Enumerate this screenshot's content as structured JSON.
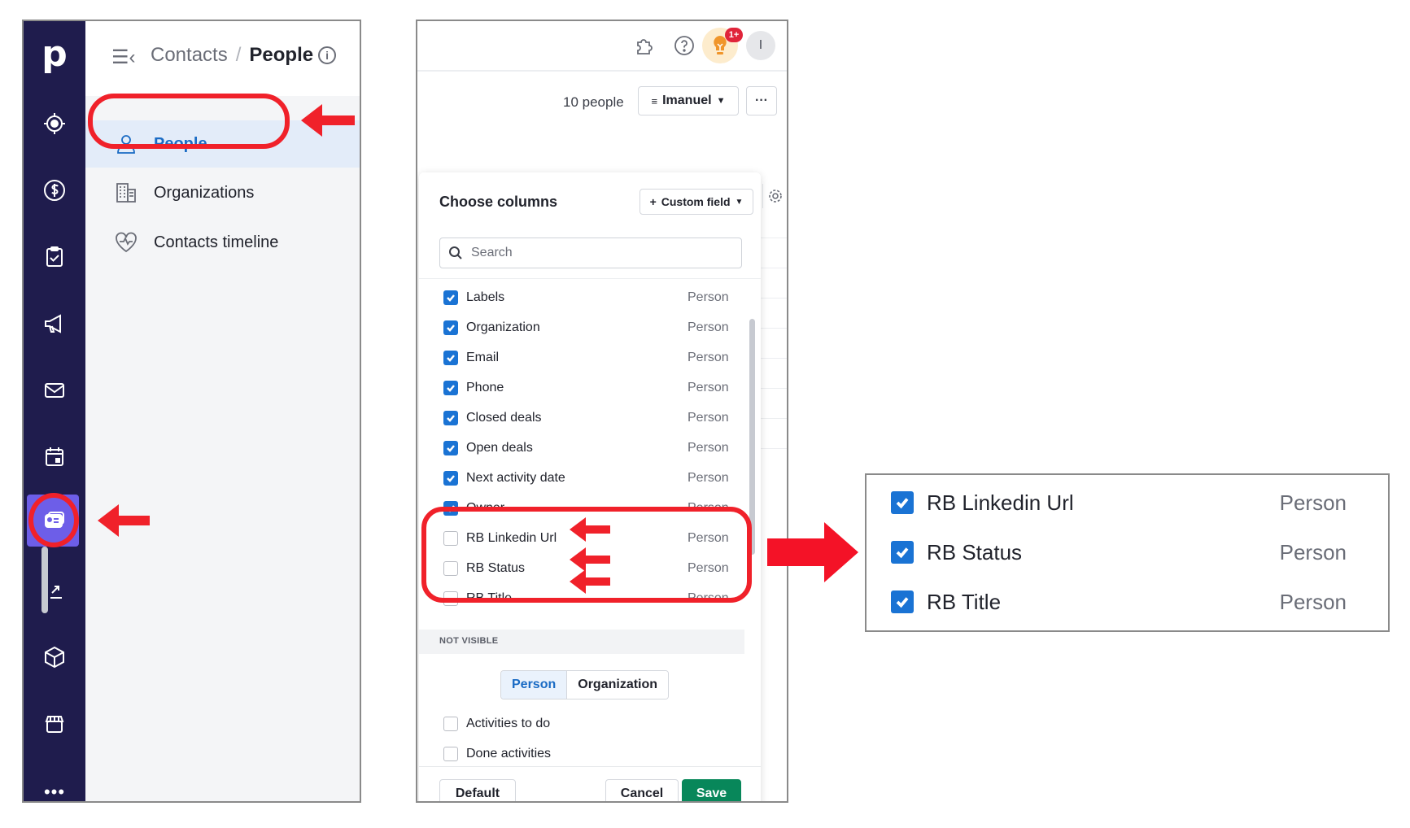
{
  "left_panel": {
    "logo": "p",
    "rail_icons": [
      "target-icon",
      "dollar-icon",
      "clipboard-check-icon",
      "megaphone-icon",
      "mail-icon",
      "calendar-icon",
      "contacts-card-icon",
      "chart-icon",
      "box-icon",
      "store-icon"
    ],
    "rail_active": "contacts-card-icon",
    "rail_more": "•••",
    "breadcrumb": {
      "parent": "Contacts",
      "separator": "/",
      "current": "People",
      "info": "i"
    },
    "nav": [
      {
        "label": "People",
        "icon": "person-icon",
        "active": true
      },
      {
        "label": "Organizations",
        "icon": "building-icon",
        "active": false
      },
      {
        "label": "Contacts timeline",
        "icon": "heart-pulse-icon",
        "active": false
      }
    ]
  },
  "middle_panel": {
    "topbar": {
      "notification_badge": "1+",
      "avatar_initial": "I"
    },
    "people_count": "10 people",
    "filter_label": "Imanuel",
    "more_label": "···",
    "choose_columns": {
      "title": "Choose columns",
      "custom_field_label": "Custom field",
      "search_placeholder": "Search",
      "visible_columns": [
        {
          "label": "Labels",
          "type": "Person",
          "checked": true
        },
        {
          "label": "Organization",
          "type": "Person",
          "checked": true
        },
        {
          "label": "Email",
          "type": "Person",
          "checked": true
        },
        {
          "label": "Phone",
          "type": "Person",
          "checked": true
        },
        {
          "label": "Closed deals",
          "type": "Person",
          "checked": true
        },
        {
          "label": "Open deals",
          "type": "Person",
          "checked": true
        },
        {
          "label": "Next activity date",
          "type": "Person",
          "checked": true
        },
        {
          "label": "Owner",
          "type": "Person",
          "checked": true
        },
        {
          "label": "RB Linkedin Url",
          "type": "Person",
          "checked": false
        },
        {
          "label": "RB Status",
          "type": "Person",
          "checked": false
        },
        {
          "label": "RB Title",
          "type": "Person",
          "checked": false
        }
      ],
      "not_visible_label": "NOT VISIBLE",
      "segments": [
        {
          "label": "Person",
          "active": true
        },
        {
          "label": "Organization",
          "active": false
        }
      ],
      "not_visible_columns": [
        {
          "label": "Activities to do",
          "checked": false
        },
        {
          "label": "Done activities",
          "checked": false
        }
      ],
      "buttons": {
        "default": "Default",
        "cancel": "Cancel",
        "save": "Save"
      }
    }
  },
  "callout": {
    "rows": [
      {
        "label": "RB Linkedin Url",
        "type": "Person",
        "checked": true
      },
      {
        "label": "RB Status",
        "type": "Person",
        "checked": true
      },
      {
        "label": "RB Title",
        "type": "Person",
        "checked": true
      }
    ]
  },
  "colors": {
    "rail_bg": "#1f1c4d",
    "rail_active": "#6d5ee8",
    "accent_blue": "#1a73d4",
    "save_green": "#08875a",
    "annotation_red": "#f0212a"
  }
}
